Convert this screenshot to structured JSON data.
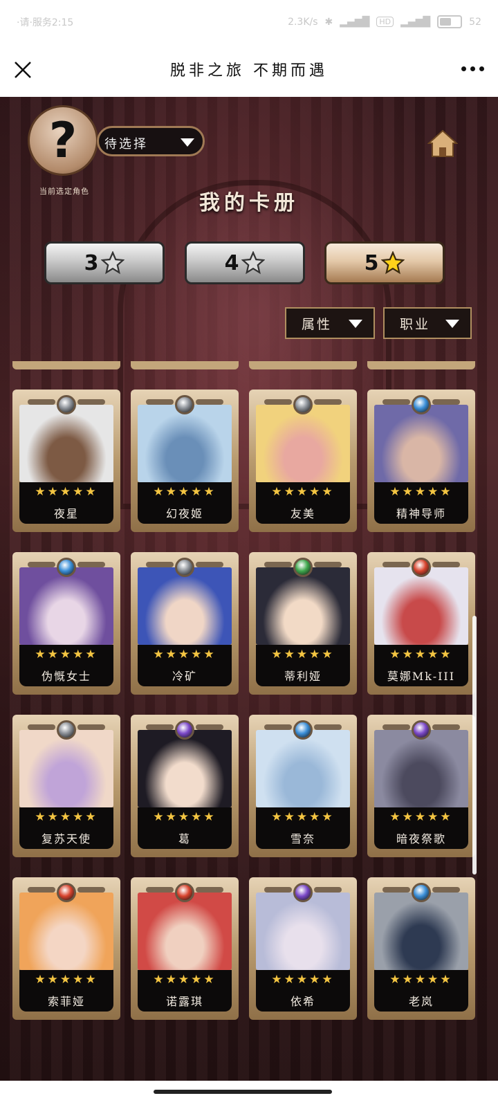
{
  "status_bar": {
    "left_text": "·请·服务2:15",
    "speed": "2.3K/s",
    "hd": "HD",
    "battery": "52"
  },
  "nav": {
    "title": "脱非之旅 不期而遇"
  },
  "player": {
    "select_label": "待选择",
    "caption": "当前选定角色",
    "avatar_glyph": "?"
  },
  "page": {
    "heading": "我的卡册"
  },
  "star_tabs": [
    {
      "label": "3",
      "selected": false
    },
    {
      "label": "4",
      "selected": false
    },
    {
      "label": "5",
      "selected": true
    }
  ],
  "filters": {
    "attribute": "属性",
    "class": "职业"
  },
  "cards": [
    {
      "name": "夜星",
      "stars": 5,
      "gem_color": "#8a8f96",
      "portrait_colors": [
        "#e6e6e6",
        "#7d5a44"
      ]
    },
    {
      "name": "幻夜姬",
      "stars": 5,
      "gem_color": "#8a8f96",
      "portrait_colors": [
        "#b9d4ea",
        "#6a8fb8"
      ]
    },
    {
      "name": "友美",
      "stars": 5,
      "gem_color": "#8a8f96",
      "portrait_colors": [
        "#f1d27d",
        "#e8a8a0"
      ]
    },
    {
      "name": "精神导师",
      "stars": 5,
      "gem_color": "#3b8fd8",
      "portrait_colors": [
        "#6f6aa8",
        "#d9b6a6"
      ]
    },
    {
      "name": "伪慨女士",
      "stars": 5,
      "gem_color": "#3b8fd8",
      "portrait_colors": [
        "#6f4f9e",
        "#e8d6e6"
      ]
    },
    {
      "name": "冷矿",
      "stars": 5,
      "gem_color": "#8a8f96",
      "portrait_colors": [
        "#3d55b7",
        "#f0d6c6"
      ]
    },
    {
      "name": "蒂利娅",
      "stars": 5,
      "gem_color": "#3fa84d",
      "portrait_colors": [
        "#2b2b38",
        "#f2dac6"
      ]
    },
    {
      "name": "莫娜Mk-III",
      "stars": 5,
      "gem_color": "#d8442e",
      "portrait_colors": [
        "#e6e3ee",
        "#c84a4a"
      ]
    },
    {
      "name": "复苏天使",
      "stars": 5,
      "gem_color": "#8a8f96",
      "portrait_colors": [
        "#f0d8c8",
        "#c0a4d8"
      ]
    },
    {
      "name": "葛",
      "stars": 5,
      "gem_color": "#7b48c8",
      "portrait_colors": [
        "#1e1b24",
        "#f2dccc"
      ]
    },
    {
      "name": "雪奈",
      "stars": 5,
      "gem_color": "#3b8fd8",
      "portrait_colors": [
        "#cfe0f0",
        "#9ab8d8"
      ]
    },
    {
      "name": "暗夜祭歌",
      "stars": 5,
      "gem_color": "#7b48c8",
      "portrait_colors": [
        "#8b8aa0",
        "#4c4a5e"
      ]
    },
    {
      "name": "索菲娅",
      "stars": 5,
      "gem_color": "#d8442e",
      "portrait_colors": [
        "#f0a45a",
        "#f4d6c4"
      ]
    },
    {
      "name": "诺露琪",
      "stars": 5,
      "gem_color": "#d8442e",
      "portrait_colors": [
        "#d14a46",
        "#f0d0c0"
      ]
    },
    {
      "name": "依希",
      "stars": 5,
      "gem_color": "#7b48c8",
      "portrait_colors": [
        "#b8bcd8",
        "#e8e0ec"
      ]
    },
    {
      "name": "老岚",
      "stars": 5,
      "gem_color": "#3b8fd8",
      "portrait_colors": [
        "#9aa0aa",
        "#2e3a52"
      ]
    }
  ]
}
